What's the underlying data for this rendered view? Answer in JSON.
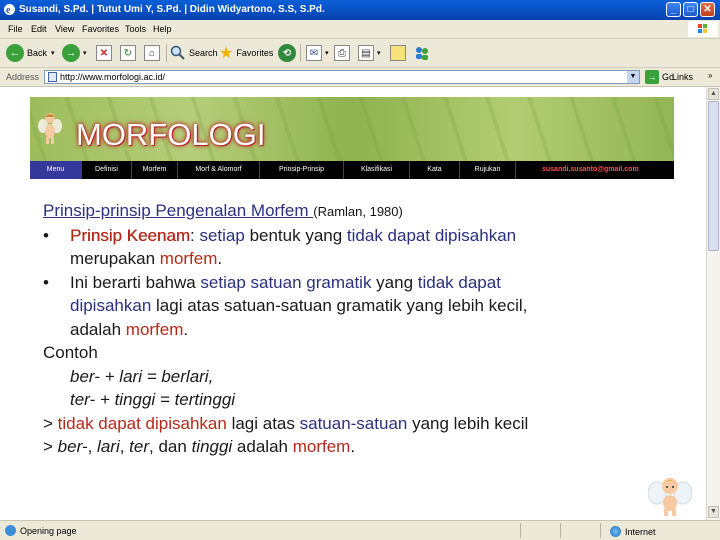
{
  "window": {
    "title": "Susandi, S.Pd. | Tutut Umi Y, S.Pd. | Didin Widyartono, S.S, S.Pd.",
    "minimize": "_",
    "maximize": "□",
    "close": "✕"
  },
  "menu": [
    "File",
    "Edit",
    "View",
    "Favorites",
    "Tools",
    "Help"
  ],
  "toolbar": {
    "back_label": "Back",
    "search_label": "Search",
    "favorites_label": "Favorites"
  },
  "address": {
    "label": "Address",
    "url": "http://www.morfologi.ac.id/",
    "go_label": "Go",
    "links_label": "Links"
  },
  "site": {
    "logo": "MORFOLOGI",
    "nav": [
      "Menu",
      "Definisi",
      "Morfem",
      "Morf & Alomorf",
      "Prinsip-Prinsip",
      "Klasifikasi",
      "Kata",
      "Rujukan"
    ],
    "email": "susandi.susanto@gmail.com"
  },
  "content": {
    "heading": "Prinsip-prinsip Pengenalan Morfem ",
    "heading_cite": "(Ramlan, 1980)",
    "b1_bullet": "•",
    "b1_bold": "Prinsip Keenam",
    "b1_colon": ": ",
    "b1_a": "setiap",
    "b1_b": " bentuk yang ",
    "b1_c": "tidak dapat dipisahkan",
    "b1_cont_a": "merupakan ",
    "b1_cont_b": "morfem",
    "b1_cont_c": ".",
    "b2_bullet": "•",
    "b2_a": "Ini berarti bahwa ",
    "b2_b": "setiap satuan gramatik",
    "b2_c": " yang ",
    "b2_d": "tidak dapat",
    "b2_l2a": "dipisahkan",
    "b2_l2b": " lagi atas satuan-satuan gramatik yang lebih kecil,",
    "b2_l3a": "adalah ",
    "b2_l3b": "morfem",
    "b2_l3c": ".",
    "contoh": "Contoh",
    "ex1": "ber- + lari  = berlari,",
    "ex2": "ter- + tinggi = tertinggi",
    "c1_a": "> ",
    "c1_b": "tidak dapat dipisahkan",
    "c1_c": " lagi atas ",
    "c1_d": "satuan-satuan",
    "c1_e": " yang lebih kecil",
    "c2_a": "> ",
    "c2_b": "ber-",
    "c2_c": ", ",
    "c2_d": "lari",
    "c2_e": ", ",
    "c2_f": "ter",
    "c2_g": ", dan ",
    "c2_h": "tinggi",
    "c2_i": " adalah ",
    "c2_j": "morfem",
    "c2_k": "."
  },
  "status": {
    "text": "Opening page",
    "zone": "Internet"
  },
  "colors": {
    "blue": "#2b3180",
    "red": "#b32a1a",
    "nav_active": "#34389a"
  }
}
